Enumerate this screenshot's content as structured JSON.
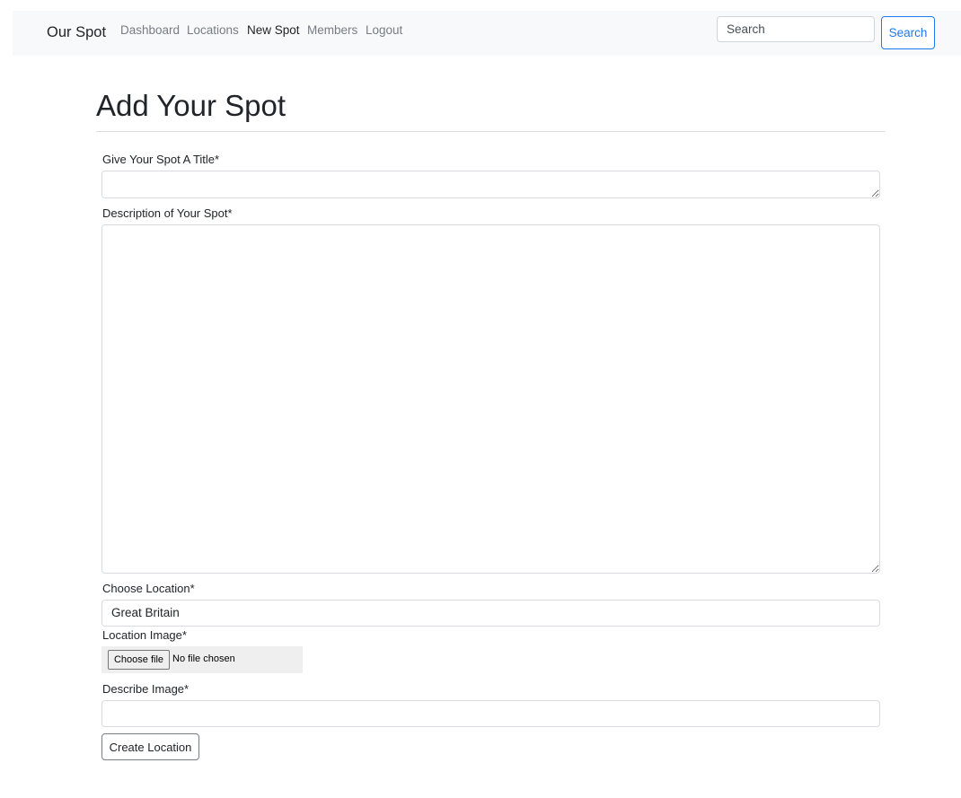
{
  "navbar": {
    "brand": "Our Spot",
    "links": [
      {
        "label": "Dashboard",
        "active": false
      },
      {
        "label": "Locations",
        "active": false
      },
      {
        "label": "New Spot",
        "active": true
      },
      {
        "label": "Members",
        "active": false
      },
      {
        "label": "Logout",
        "active": false
      }
    ],
    "search": {
      "placeholder": "Search",
      "value": "",
      "button_label": "Search"
    }
  },
  "page": {
    "title": "Add Your Spot"
  },
  "form": {
    "title_label": "Give Your Spot A Title*",
    "title_value": "",
    "description_label": "Description of Your Spot*",
    "description_value": "",
    "location_label": "Choose Location*",
    "location_selected": "Great Britain",
    "image_label": "Location Image*",
    "file_button_label": "Choose file",
    "file_status": "No file chosen",
    "image_description_label": "Describe Image*",
    "image_description_value": "",
    "submit_label": "Create Location"
  },
  "colors": {
    "navbar_bg": "#f8f9fa",
    "primary": "#1b7bf2",
    "link_muted": "#777d83",
    "text": "#212529"
  }
}
